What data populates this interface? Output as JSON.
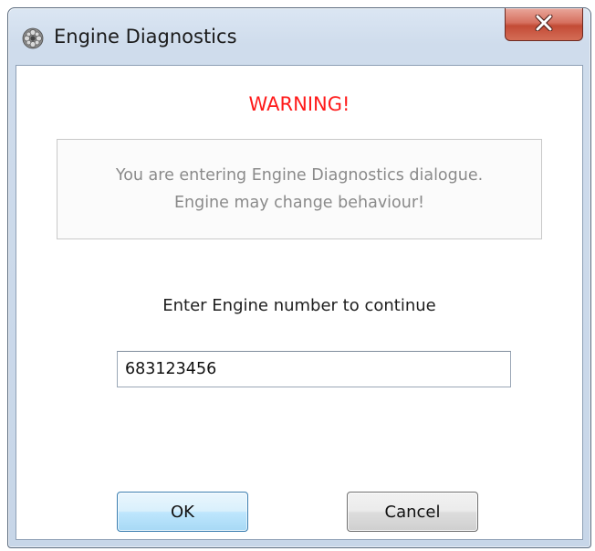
{
  "window": {
    "title": "Engine Diagnostics",
    "icon": "gear-icon",
    "close_icon": "close-icon"
  },
  "dialog": {
    "warning_title": "WARNING!",
    "message_line1": "You are entering Engine Diagnostics dialogue.",
    "message_line2": "Engine may change behaviour!",
    "prompt": "Enter Engine number to continue",
    "engine_number_value": "683123456",
    "ok_label": "OK",
    "cancel_label": "Cancel"
  },
  "colors": {
    "warning": "#ff1a1a",
    "message_text": "#8a8a8a",
    "close_button": "#c34b36",
    "default_button_border": "#3c7fb1"
  }
}
